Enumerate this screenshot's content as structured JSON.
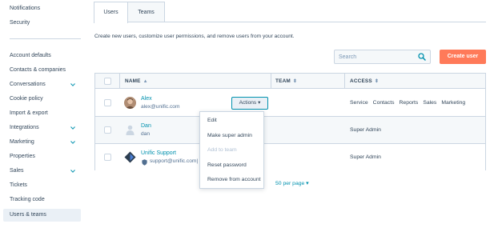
{
  "sidebar": {
    "top_items": [
      {
        "label": "Notifications"
      },
      {
        "label": "Security"
      }
    ],
    "items": [
      {
        "label": "Account defaults",
        "expandable": false
      },
      {
        "label": "Contacts & companies",
        "expandable": false
      },
      {
        "label": "Conversations",
        "expandable": true
      },
      {
        "label": "Cookie policy",
        "expandable": false
      },
      {
        "label": "Import & export",
        "expandable": false
      },
      {
        "label": "Integrations",
        "expandable": true
      },
      {
        "label": "Marketing",
        "expandable": true
      },
      {
        "label": "Properties",
        "expandable": false
      },
      {
        "label": "Sales",
        "expandable": true
      },
      {
        "label": "Tickets",
        "expandable": false
      },
      {
        "label": "Tracking code",
        "expandable": false
      },
      {
        "label": "Users & teams",
        "expandable": false,
        "active": true
      }
    ]
  },
  "tabs": [
    {
      "label": "Users",
      "active": true
    },
    {
      "label": "Teams",
      "active": false
    }
  ],
  "description": "Create new users, customize user permissions, and remove users from your account.",
  "search": {
    "placeholder": "Search",
    "value": ""
  },
  "create_button": "Create user",
  "table": {
    "columns": [
      {
        "label": "NAME",
        "sort": "▲"
      },
      {
        "label": "TEAM",
        "sort": "⬍"
      },
      {
        "label": "ACCESS",
        "sort": "⬍"
      }
    ],
    "rows": [
      {
        "name": "Alex",
        "email": "alex@unific.com",
        "team": "",
        "access": [
          "Service",
          "Contacts",
          "Reports",
          "Sales",
          "Marketing"
        ],
        "actions_label": "Actions ▾"
      },
      {
        "name": "Dan",
        "email": "dan",
        "team": "",
        "access": [
          "Super Admin"
        ]
      },
      {
        "name": "Unific Support",
        "email": "support@unific.com| I",
        "team": "",
        "access": [
          "Super Admin"
        ]
      }
    ]
  },
  "actions_menu": [
    {
      "label": "Edit",
      "disabled": false
    },
    {
      "label": "Make super admin",
      "disabled": false
    },
    {
      "label": "Add to team",
      "disabled": true
    },
    {
      "label": "Reset password",
      "disabled": false
    },
    {
      "label": "Remove from account",
      "disabled": false
    }
  ],
  "pager": {
    "label": "50 per page ▾"
  },
  "colors": {
    "accent": "#ff7a59",
    "link": "#0091ae",
    "text": "#33475b",
    "border": "#cbd6e2",
    "active_bg": "#eaf0f6"
  }
}
